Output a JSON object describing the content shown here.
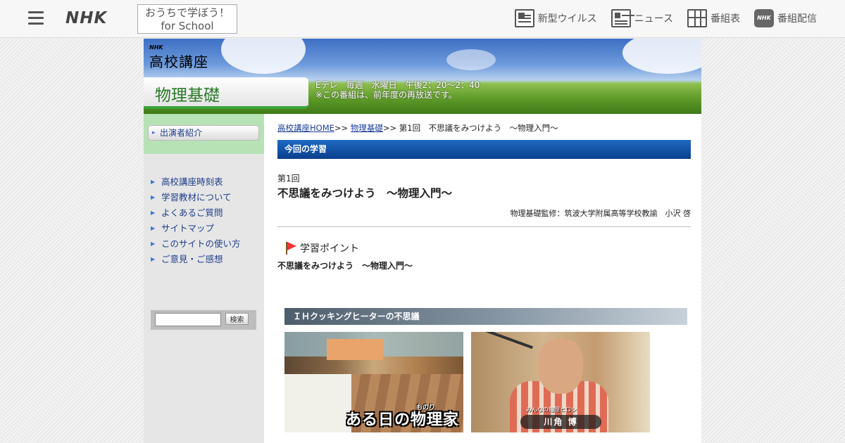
{
  "header": {
    "brand": "NHK",
    "school_line1": "おうちで学ぼう！",
    "school_line2": "for School",
    "nav": [
      {
        "label": "新型ウイルス",
        "icon": "virus-icon"
      },
      {
        "label": "ニュース",
        "icon": "news-icon"
      },
      {
        "label": "番組表",
        "icon": "schedule-grid-icon"
      },
      {
        "label": "番組配信",
        "icon": "nhk-plus-icon"
      }
    ]
  },
  "banner": {
    "logo_small": "NHK",
    "logo_text": "高校講座",
    "subject": "物理基礎",
    "air_line1": "Eテレ　毎週　水曜日　午後2：20～2：40",
    "air_line2": "※この番組は、前年度の再放送です。"
  },
  "sidebar": {
    "cast_button": "出演者紹介",
    "links": [
      "高校講座時刻表",
      "学習教材について",
      "よくあるご質問",
      "サイトマップ",
      "このサイトの使い方",
      "ご意見・ご感想"
    ],
    "search_placeholder": "",
    "search_button": "検索"
  },
  "content": {
    "breadcrumb": {
      "home": "高校講座HOME",
      "sep1": ">> ",
      "subject": "物理基礎",
      "sep2": ">> ",
      "current": "第1回　不思議をみつけよう　～物理入門～"
    },
    "section_title": "今回の学習",
    "episode_number": "第1回",
    "episode_title": "不思議をみつけよう　～物理入門～",
    "supervisor": "物理基礎監修：筑波大学附属高等学校教諭　小沢 啓",
    "point_heading": "学習ポイント",
    "point_text": "不思議をみつけよう　～物理入門～",
    "segment_title": "ＩＨクッキングヒーターの不思議",
    "thumb1_caption": "ある日の物理家",
    "thumb1_ruby": "ものり",
    "thumb2_role": "みんなの物理ヒロシ",
    "thumb2_name": "川角 博"
  }
}
